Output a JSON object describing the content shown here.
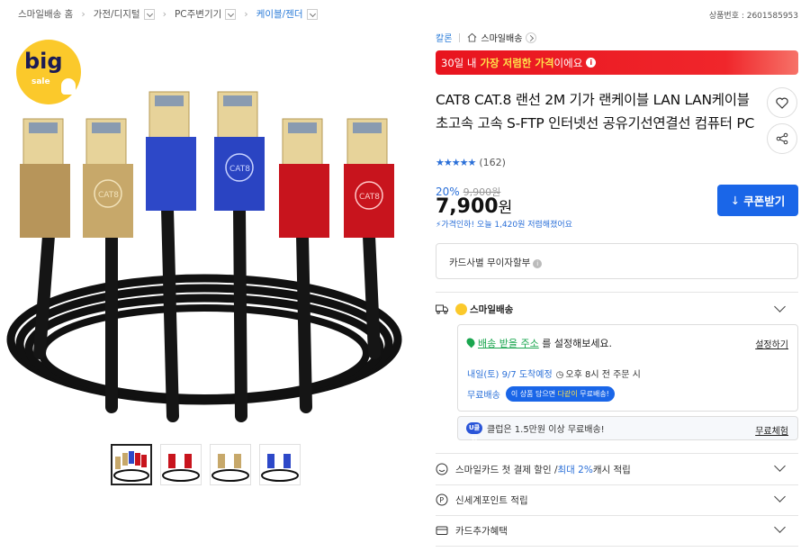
{
  "breadcrumb": [
    {
      "label": "스마일배송 홈",
      "dropdown": false,
      "active": false
    },
    {
      "label": "가전/디지털",
      "dropdown": true,
      "active": false
    },
    {
      "label": "PC주변기기",
      "dropdown": true,
      "active": false
    },
    {
      "label": "케이블/젠더",
      "dropdown": true,
      "active": true
    }
  ],
  "product_no": "상품번호 : 2601585953",
  "badge": {
    "big": "big",
    "sale": "sale"
  },
  "thumbnails_count": 4,
  "brand": "칼론",
  "store": "스마일배송",
  "promo": {
    "pre": "30일 내 ",
    "highlight": "가장 저렴한 가격",
    "post": "이에요"
  },
  "title": "CAT8 CAT.8 랜선 2M 기가 랜케이블 LAN LAN케이블 초고속 고속 S-FTP 인터넷선 공유기선연결선 컴퓨터 PC",
  "rating": {
    "stars": "★★★★★",
    "count": "(162)"
  },
  "price": {
    "discount": "20%",
    "original": "9,900원",
    "current": "7,900",
    "unit": "원",
    "cheaper_note": "가격인하! 오늘 1,420원 저렴해졌어요"
  },
  "coupon_button": "쿠폰받기",
  "card_installment": "카드사별 무이자할부",
  "shipping": {
    "label": "스마일배송",
    "address_link": "배송 받을 주소",
    "address_text": "를 설정해보세요.",
    "set_link": "설정하기",
    "arrival": "내일(토) 9/7 도착예정",
    "arrival_note": "오후 8시 전 주문 시",
    "free": "무료배송",
    "bubble_pre": "이 상품 담으면 ",
    "bubble_highlight": "다같이",
    "bubble_post": " 무료배송!"
  },
  "club": {
    "badge": "U클럽",
    "text": "클럽은 1.5만원 이상 무료배송!",
    "link": "무료체험"
  },
  "rows": [
    {
      "pre": "스마일카드 첫 결제 할인 / ",
      "blue": "최대 2%",
      "post": " 캐시 적립"
    },
    {
      "pre": "신세계포인트 적립",
      "blue": "",
      "post": ""
    },
    {
      "pre": "카드추가혜택",
      "blue": "",
      "post": ""
    }
  ]
}
